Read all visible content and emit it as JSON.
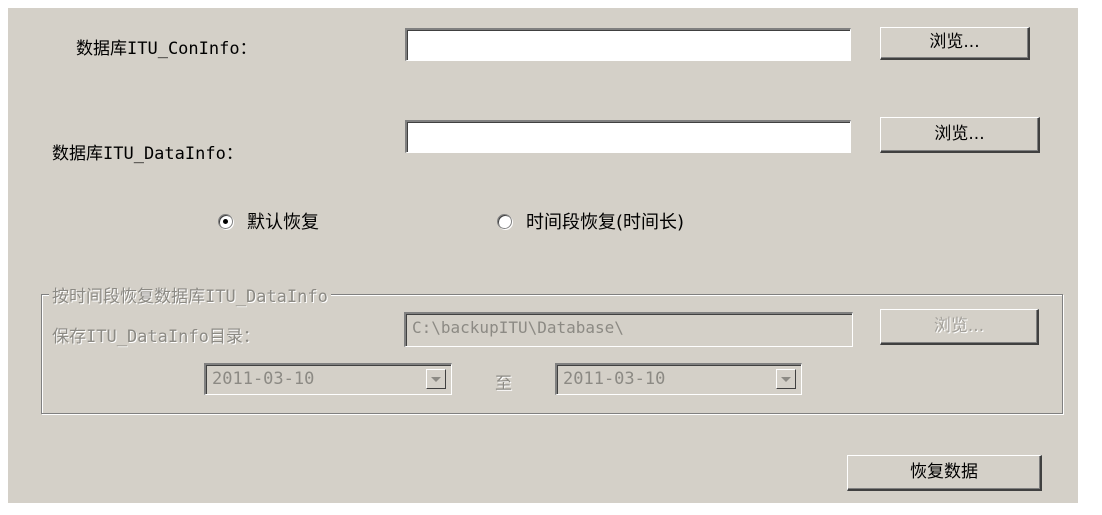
{
  "form": {
    "coninfo_label": "数据库ITU_ConInfo：",
    "coninfo_value": "",
    "datainfo_label": "数据库ITU_DataInfo：",
    "datainfo_value": "",
    "browse_label": "浏览..."
  },
  "mode": {
    "default_label": "默认恢复",
    "default_checked": true,
    "range_label": "时间段恢复(时间长)",
    "range_checked": false
  },
  "range_group": {
    "title": "按时间段恢复数据库ITU_DataInfo",
    "dir_label": "保存ITU_DataInfo目录：",
    "dir_value": "C:\\backupITU\\Database\\",
    "browse_label": "浏览...",
    "start_date": "2011-03-10",
    "to_label": "至",
    "end_date": "2011-03-10"
  },
  "restore_button": "恢复数据"
}
